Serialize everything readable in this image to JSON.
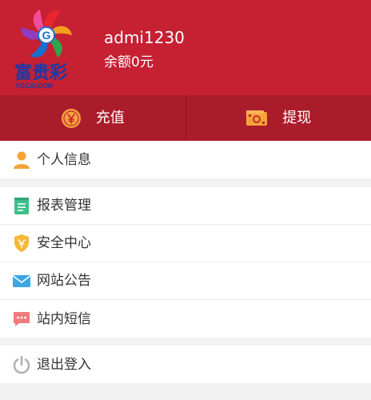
{
  "brand": {
    "logo_text": "富贵彩",
    "logo_domain": "FGCAI.COM"
  },
  "account": {
    "username": "admi1230",
    "balance": "余额0元"
  },
  "actions": {
    "deposit_label": "充值",
    "withdraw_label": "提现"
  },
  "menu": {
    "profile": {
      "label": "个人信息",
      "icon": "user-icon"
    },
    "reports": {
      "label": "报表管理",
      "icon": "notepad-icon"
    },
    "security": {
      "label": "安全中心",
      "icon": "shield-icon"
    },
    "notice": {
      "label": "网站公告",
      "icon": "mail-icon"
    },
    "messages": {
      "label": "站内短信",
      "icon": "chat-bubble-icon"
    },
    "logout": {
      "label": "退出登入",
      "icon": "power-icon"
    }
  },
  "colors": {
    "header_red": "#c62033",
    "action_bar_red": "#ab1c2b",
    "icon_orange": "#f5a43a",
    "icon_green": "#3dbf8a",
    "icon_blue": "#3aa6e6",
    "icon_pink": "#f07b7b",
    "icon_gray": "#b3b3b3"
  }
}
